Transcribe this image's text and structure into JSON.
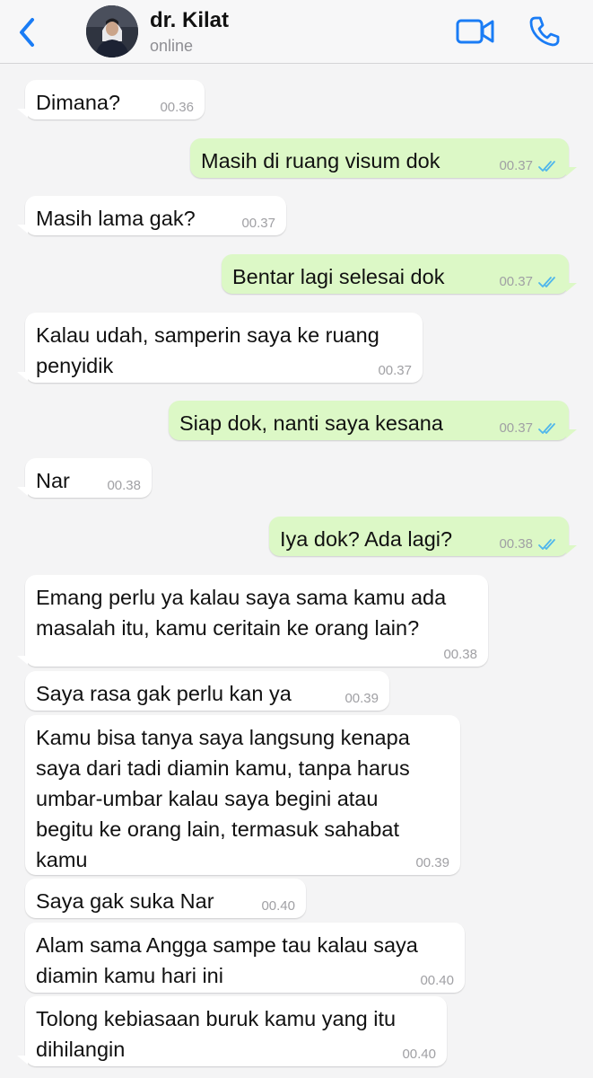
{
  "header": {
    "contact_name": "dr. Kilat",
    "status": "online"
  },
  "icons": {
    "back": "chevron-left-icon",
    "video": "video-camera-icon",
    "call": "phone-icon",
    "read_receipt": "double-check-icon"
  },
  "colors": {
    "accent": "#1a7cf5",
    "outgoing_bubble": "#dcf8c6",
    "incoming_bubble": "#ffffff",
    "read_ticks": "#4fb6ec",
    "background": "#f4f4f5"
  },
  "messages": [
    {
      "direction": "in",
      "text": "Dimana?",
      "time": "00.36"
    },
    {
      "direction": "out",
      "text": "Masih di ruang visum dok",
      "time": "00.37",
      "read": true
    },
    {
      "direction": "in",
      "text": "Masih lama gak?",
      "time": "00.37"
    },
    {
      "direction": "out",
      "text": "Bentar lagi selesai dok",
      "time": "00.37",
      "read": true
    },
    {
      "direction": "in",
      "text": "Kalau udah, samperin saya ke ruang\npenyidik",
      "time": "00.37"
    },
    {
      "direction": "out",
      "text": "Siap dok, nanti saya kesana",
      "time": "00.37",
      "read": true
    },
    {
      "direction": "in",
      "text": "Nar",
      "time": "00.38"
    },
    {
      "direction": "out",
      "text": "Iya dok? Ada lagi?",
      "time": "00.38",
      "read": true
    },
    {
      "direction": "in",
      "text": "Emang perlu ya kalau saya sama kamu ada\nmasalah itu, kamu ceritain ke orang lain?",
      "time": "00.38"
    },
    {
      "direction": "in",
      "text": "Saya rasa gak perlu kan ya",
      "time": "00.39"
    },
    {
      "direction": "in",
      "text": "Kamu bisa tanya saya langsung kenapa\nsaya dari tadi diamin kamu, tanpa harus\numbar-umbar kalau saya begini atau\nbegitu ke orang lain, termasuk sahabat\nkamu",
      "time": "00.39"
    },
    {
      "direction": "in",
      "text": "Saya gak suka Nar",
      "time": "00.40"
    },
    {
      "direction": "in",
      "text": "Alam sama Angga sampe tau kalau saya\ndiamin kamu hari ini",
      "time": "00.40"
    },
    {
      "direction": "in",
      "text": "Tolong kebiasaan buruk kamu yang itu\ndihilangin",
      "time": "00.40"
    }
  ]
}
